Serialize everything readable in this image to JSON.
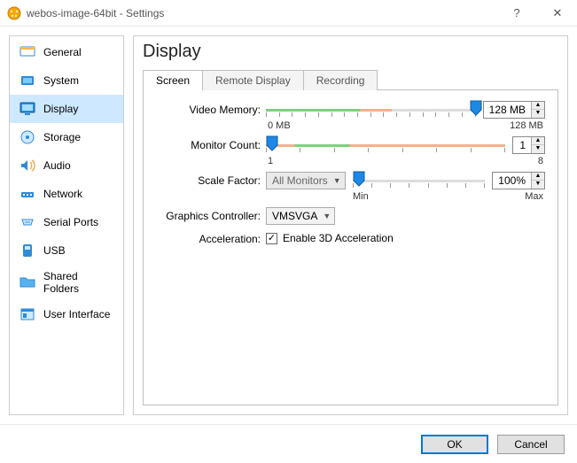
{
  "window": {
    "title": "webos-image-64bit - Settings",
    "help_btn": "?",
    "close_btn": "✕"
  },
  "sidebar": {
    "items": [
      {
        "label": "General"
      },
      {
        "label": "System"
      },
      {
        "label": "Display"
      },
      {
        "label": "Storage"
      },
      {
        "label": "Audio"
      },
      {
        "label": "Network"
      },
      {
        "label": "Serial Ports"
      },
      {
        "label": "USB"
      },
      {
        "label": "Shared Folders"
      },
      {
        "label": "User Interface"
      }
    ],
    "selected_index": 2
  },
  "main": {
    "heading": "Display",
    "tabs": [
      {
        "label": "Screen"
      },
      {
        "label": "Remote Display"
      },
      {
        "label": "Recording"
      }
    ],
    "active_tab": 0,
    "video_memory": {
      "label": "Video Memory:",
      "value_text": "128 MB",
      "min_label": "0 MB",
      "max_label": "128 MB",
      "thumb_pos_pct": 97
    },
    "monitor_count": {
      "label": "Monitor Count:",
      "value_text": "1",
      "min_label": "1",
      "max_label": "8",
      "thumb_pos_pct": 0
    },
    "scale_factor": {
      "label": "Scale Factor:",
      "selector_text": "All Monitors",
      "value_text": "100%",
      "min_label": "Min",
      "max_label": "Max",
      "thumb_pos_pct": 0
    },
    "graphics_controller": {
      "label": "Graphics Controller:",
      "value": "VMSVGA"
    },
    "acceleration": {
      "label": "Acceleration:",
      "checkbox_label": "Enable 3D Acceleration",
      "checked": true
    }
  },
  "buttons": {
    "ok": "OK",
    "cancel": "Cancel"
  }
}
